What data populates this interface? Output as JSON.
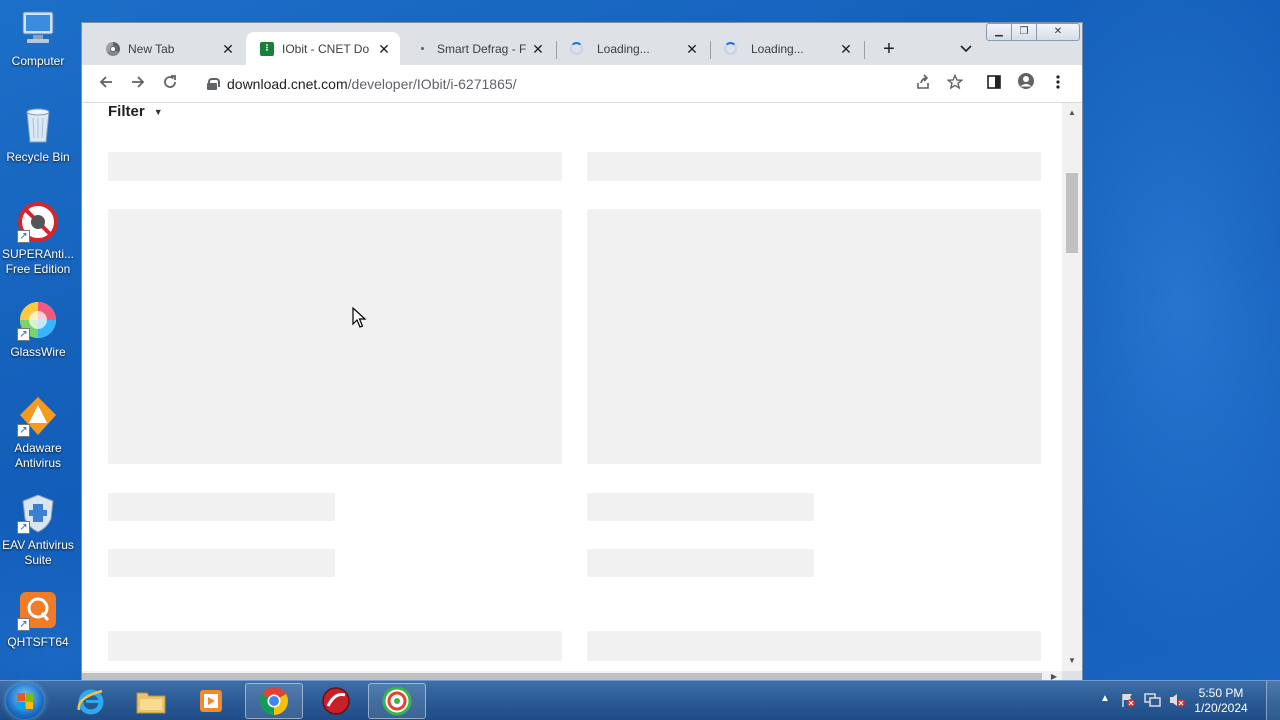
{
  "desktop": {
    "icons": [
      {
        "label": "Computer"
      },
      {
        "label": "Recycle Bin"
      },
      {
        "label": "SUPERAnti... Free Edition"
      },
      {
        "label": "GlassWire"
      },
      {
        "label": "Adaware Antivirus"
      },
      {
        "label": "EAV Antivirus Suite"
      },
      {
        "label": "QHTSFT64"
      }
    ]
  },
  "browser": {
    "tabs": [
      {
        "title": "New Tab",
        "favicon": "chrome-icon",
        "active": false
      },
      {
        "title": "IObit - CNET Do",
        "favicon": "cnet-icon",
        "active": true
      },
      {
        "title": "Smart Defrag - F",
        "favicon": "dot-icon",
        "active": false
      },
      {
        "title": "Loading...",
        "favicon": "spinner-icon",
        "active": false
      },
      {
        "title": "Loading...",
        "favicon": "spinner-icon",
        "active": false
      }
    ],
    "url_host": "download.cnet.com",
    "url_path": "/developer/IObit/i-6271865/",
    "page": {
      "filter_label": "Filter"
    }
  },
  "taskbar": {
    "apps": [
      "internet-explorer",
      "windows-explorer",
      "media-player",
      "chrome",
      "app-red-circle",
      "app-green-target"
    ],
    "clock_time": "5:50 PM",
    "clock_date": "1/20/2024"
  }
}
